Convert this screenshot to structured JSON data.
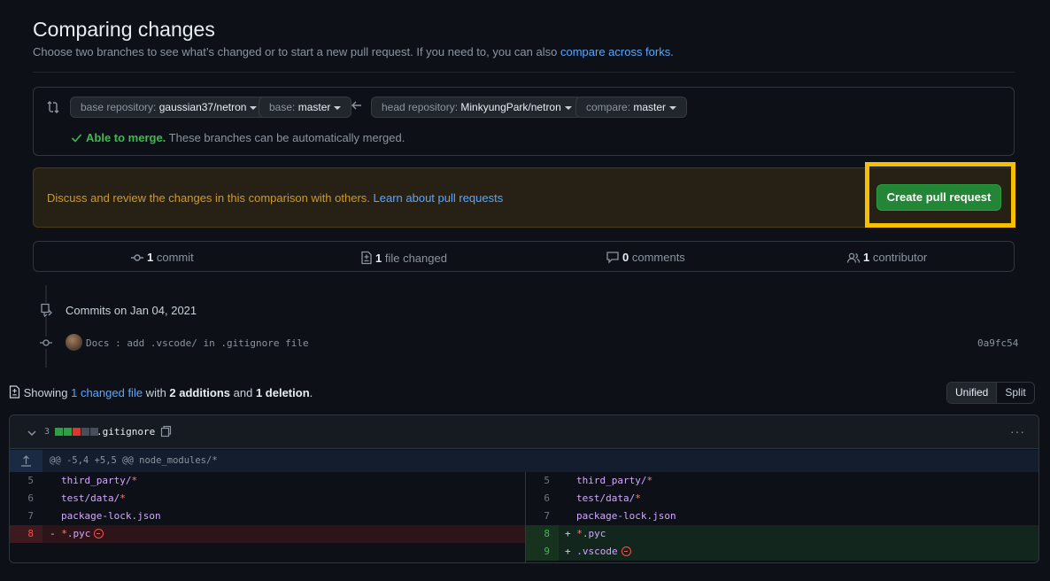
{
  "page": {
    "title": "Comparing changes",
    "subtitle_text": "Choose two branches to see what’s changed or to start a new pull request. If you need to, you can also ",
    "subtitle_link": "compare across forks",
    "subtitle_end": "."
  },
  "range": {
    "base_repo_label": "base repository: ",
    "base_repo_value": "gaussian37/netron",
    "base_label": "base: ",
    "base_value": "master",
    "head_repo_label": "head repository: ",
    "head_repo_value": "MinkyungPark/netron",
    "compare_label": "compare: ",
    "compare_value": "master",
    "merge_ok": "Able to merge.",
    "merge_text": " These branches can be automatically merged."
  },
  "discuss": {
    "text": "Discuss and review the changes in this comparison with others. ",
    "link": "Learn about pull requests",
    "button": "Create pull request"
  },
  "stats": {
    "commits_num": "1",
    "commits_label": " commit",
    "files_num": "1",
    "files_label": " file changed",
    "comments_num": "0",
    "comments_label": " comments",
    "contributors_num": "1",
    "contributors_label": " contributor"
  },
  "commits": {
    "date_heading": "Commits on Jan 04, 2021",
    "message": "Docs : add .vscode/ in .gitignore file",
    "sha": "0a9fc54"
  },
  "summary": {
    "prefix": "Showing ",
    "changed_link": "1 changed file",
    "with": " with ",
    "additions": "2 additions",
    "and": " and ",
    "deletions": "1 deletion",
    "end": "."
  },
  "view_toggle": {
    "unified": "Unified",
    "split": "Split"
  },
  "diff": {
    "count": "3",
    "file": ".gitignore",
    "menu": "···",
    "hunk": "@@ -5,4 +5,5 @@ node_modules/*",
    "left": [
      {
        "num": "5",
        "path": "third_party/",
        "star": "*"
      },
      {
        "num": "6",
        "path": "test/data/",
        "star": "*"
      },
      {
        "num": "7",
        "path": "package-lock.json",
        "star": ""
      },
      {
        "num": "8",
        "sign": "- ",
        "star": "*",
        "path": ".pyc"
      }
    ],
    "right": [
      {
        "num": "5",
        "path": "third_party/",
        "star": "*"
      },
      {
        "num": "6",
        "path": "test/data/",
        "star": "*"
      },
      {
        "num": "7",
        "path": "package-lock.json",
        "star": ""
      },
      {
        "num": "8",
        "sign": "+ ",
        "star": "*",
        "path": ".pyc"
      },
      {
        "num": "9",
        "sign": "+ ",
        "star": "",
        "path": ".vscode"
      }
    ]
  },
  "colors": {
    "accent": "#58a6ff",
    "success": "#3fb950",
    "button": "#238636",
    "warning_text": "#d29922",
    "highlight": "#f6c000"
  }
}
